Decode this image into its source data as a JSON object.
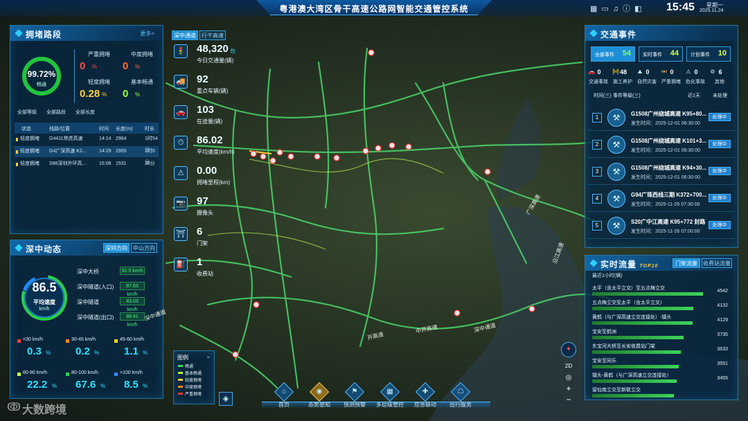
{
  "header": {
    "title": "粤港澳大湾区骨干高速公路网智能交通管控系统",
    "time": "15:45",
    "weekday": "星期一",
    "date": "2025.11.24"
  },
  "congestion": {
    "title": "拥堵路段",
    "more": "更多>",
    "ratio": "99.72%",
    "ratio_label": "畅通",
    "ratio_value": 0.9972,
    "stats": [
      {
        "label": "严重拥堵",
        "value": "0",
        "unit": "%",
        "color": "#ff4a3a"
      },
      {
        "label": "中度拥堵",
        "value": "0",
        "unit": "%",
        "color": "#ff6a3a"
      },
      {
        "label": "轻度拥堵",
        "value": "0.28",
        "unit": "%",
        "color": "#ffd23a"
      },
      {
        "label": "基本畅通",
        "value": "0",
        "unit": "%",
        "color": "#9dff3a"
      }
    ],
    "filters": [
      "全部等级",
      "全部路段",
      "全部长度"
    ],
    "columns": [
      "状态",
      "线路/位置",
      "时间",
      "长度(m)",
      "时长"
    ],
    "rows": [
      [
        "轻度拥堵",
        "G4411常虎高速",
        "14:14",
        "2964",
        "1时54分"
      ],
      [
        "轻度拥堵",
        "G4广深高速 K2...",
        "14:29",
        "2955",
        "1时0分"
      ],
      [
        "轻度拥堵",
        "S86深圳外环高...",
        "15:08",
        "1531",
        "30分"
      ]
    ]
  },
  "szdyn": {
    "title": "深中动态",
    "tabs": [
      "深圳方向",
      "中山方向"
    ],
    "speed": "86.5",
    "speed_label": "平均速度",
    "speed_unit": "km/h",
    "roads": [
      {
        "name": "深中大桥",
        "value": "92.5 km/h"
      },
      {
        "name": "深中隧道(入口)",
        "value": "87.63 km/h"
      },
      {
        "name": "深中隧道",
        "value": "83.03 km/h"
      },
      {
        "name": "深中隧道(出口)",
        "value": "88.41 km/h"
      }
    ],
    "dist": [
      {
        "label": "<30 km/h",
        "value": "0.3",
        "unit": "%",
        "color": "#ff3c3c"
      },
      {
        "label": "30-45 km/h",
        "value": "0.2",
        "unit": "%",
        "color": "#ff8a1a"
      },
      {
        "label": "45-60 km/h",
        "value": "1.1",
        "unit": "%",
        "color": "#ffd21a"
      },
      {
        "label": "60-80 km/h",
        "value": "22.2",
        "unit": "%",
        "color": "#c8ff3a"
      },
      {
        "label": "80-100 km/h",
        "value": "67.6",
        "unit": "%",
        "color": "#2fd14a"
      },
      {
        "label": ">100 km/h",
        "value": "8.5",
        "unit": "%",
        "color": "#2b8cff"
      }
    ]
  },
  "maptabs": [
    "深中通道",
    "行干高速"
  ],
  "kpis": [
    {
      "icon": "🚦",
      "value": "48,320",
      "unit": "台",
      "label": "今日交通量(辆)"
    },
    {
      "icon": "🚚",
      "value": "92",
      "unit": "",
      "label": "重点车辆(辆)"
    },
    {
      "icon": "🚗",
      "value": "103",
      "unit": "",
      "label": "在途量(辆)"
    },
    {
      "icon": "⏱",
      "value": "86.02",
      "unit": "",
      "label": "平均速度(km/h)"
    },
    {
      "icon": "⚠",
      "value": "0.00",
      "unit": "",
      "label": "拥堵里程(km)"
    },
    {
      "icon": "📷",
      "value": "97",
      "unit": "",
      "label": "摄像头"
    },
    {
      "icon": "⛩",
      "value": "6",
      "unit": "",
      "label": "门架"
    },
    {
      "icon": "⛽",
      "value": "1",
      "unit": "",
      "label": "收费站"
    }
  ],
  "places": [
    "深中通道",
    "开高速",
    "中开高速",
    "深中通道",
    "广深高速",
    "沿江高速"
  ],
  "legend": {
    "title": "图例",
    "items": [
      {
        "label": "畅通",
        "color": "#3ddc5a"
      },
      {
        "label": "基本畅通",
        "color": "#b8ff3a"
      },
      {
        "label": "轻度拥堵",
        "color": "#ffd23a"
      },
      {
        "label": "中度拥堵",
        "color": "#ff8a1a"
      },
      {
        "label": "严重拥堵",
        "color": "#ff3030"
      }
    ]
  },
  "nav": [
    {
      "label": "首页",
      "icon": "⌂"
    },
    {
      "label": "态势感知",
      "icon": "◉"
    },
    {
      "label": "预测预警",
      "icon": "⚑"
    },
    {
      "label": "多层级管控",
      "icon": "▦"
    },
    {
      "label": "应急联动",
      "icon": "✚"
    },
    {
      "label": "出行服务",
      "icon": "☖"
    }
  ],
  "mapctrl": {
    "mode": "2D",
    "plus": "+",
    "minus": "−"
  },
  "events": {
    "title": "交通事件",
    "tabs": [
      {
        "label": "全部事件",
        "count": "54"
      },
      {
        "label": "实时事件",
        "count": "44"
      },
      {
        "label": "计划事件",
        "count": "10"
      }
    ],
    "cats": [
      {
        "icon": "🚗",
        "label": "交通事故",
        "count": "0"
      },
      {
        "icon": "🚧",
        "label": "施工养护",
        "count": "48"
      },
      {
        "icon": "⛰",
        "label": "自然灾害",
        "count": "0"
      },
      {
        "icon": "🚥",
        "label": "严重拥堵",
        "count": "0"
      },
      {
        "icon": "⚠",
        "label": "危化事故",
        "count": "0"
      },
      {
        "icon": "⚙",
        "label": "其他",
        "count": "6"
      }
    ],
    "filters": [
      "时间(三)",
      "事件等级(三)",
      "近1天",
      "未处理"
    ],
    "items": [
      {
        "no": "1",
        "title": "G1508广州绕城高速 K95+80...",
        "time": "发生时间：2025-12-01 06:30:00",
        "btn": "处理中"
      },
      {
        "no": "2",
        "title": "G1508广州绕城高速 K101+3...",
        "time": "发生时间：2025-12-01 06:30:00",
        "btn": "处理中"
      },
      {
        "no": "3",
        "title": "G1508广州绕城高速 K94+30...",
        "time": "发生时间：2025-12-01 06:30:00",
        "btn": "处理中"
      },
      {
        "no": "4",
        "title": "G94广珠西线三期 K372+700...",
        "time": "发生时间：2025-11-26 07:30:00",
        "btn": "处理中"
      },
      {
        "no": "5",
        "title": "S20广中江高速 K95+772 封路",
        "time": "发生时间：2025-11-26 07:00:00",
        "btn": "处理中"
      }
    ]
  },
  "flow": {
    "title": "实时流量",
    "badge": "TOP10",
    "tabs": [
      "门架流量",
      "收费站流量"
    ],
    "sub": "最近1小时(辆)",
    "items": [
      {
        "name": "太平（含太平立交）至五点梅立交",
        "value": "4542",
        "ratio": 1
      },
      {
        "name": "五点梅立交至太平（含太平立交）",
        "value": "4132",
        "ratio": 0.91
      },
      {
        "name": "黄鹤（与广深高速立交连接处）-镇头",
        "value": "4129",
        "ratio": 0.909
      },
      {
        "name": "宝安至鹤洲",
        "value": "3735",
        "ratio": 0.822
      },
      {
        "name": "东宝河大桥至长安收费站门架",
        "value": "3633",
        "ratio": 0.8
      },
      {
        "name": "宝安至同乐",
        "value": "3551",
        "ratio": 0.782
      },
      {
        "name": "镇头-黄鹤（与广深高速立交连接处）",
        "value": "3455",
        "ratio": 0.761
      },
      {
        "name": "留仙南立交至新联立交",
        "value": "",
        "ratio": 0.74
      }
    ]
  },
  "watermark": "大数跨境"
}
